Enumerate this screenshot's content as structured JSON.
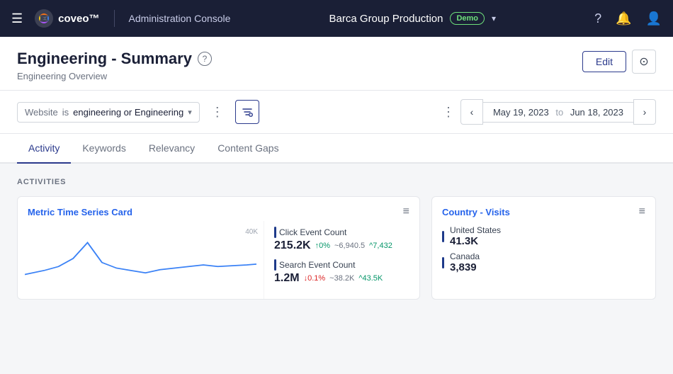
{
  "topnav": {
    "menu_icon": "☰",
    "logo_alt": "Coveo",
    "app_title": "Administration Console",
    "org_name": "Barca Group Production",
    "demo_badge": "Demo",
    "help_icon": "?",
    "bell_icon": "🔔",
    "user_icon": "👤"
  },
  "page": {
    "title": "Engineering - Summary",
    "subtitle": "Engineering Overview",
    "edit_label": "Edit",
    "settings_icon": "⊙"
  },
  "filter_bar": {
    "filter_label": "Website",
    "filter_is": "is",
    "filter_value": "engineering or Engineering",
    "more_icon": "⋮",
    "add_filter_icon": "+",
    "date_prev_icon": "‹",
    "date_next_icon": "›",
    "date_start": "May 19, 2023",
    "date_to": "to",
    "date_end": "Jun 18, 2023"
  },
  "tabs": [
    {
      "id": "activity",
      "label": "Activity",
      "active": true
    },
    {
      "id": "keywords",
      "label": "Keywords",
      "active": false
    },
    {
      "id": "relevancy",
      "label": "Relevancy",
      "active": false
    },
    {
      "id": "content-gaps",
      "label": "Content Gaps",
      "active": false
    }
  ],
  "activities_section": {
    "label": "ACTIVITIES"
  },
  "metric_card": {
    "title": "Metric Time Series Card",
    "chart_label": "40K",
    "metrics": [
      {
        "name": "Click Event Count",
        "value": "215.2K",
        "change1": "↑0%",
        "change2": "~6,940.5",
        "change3": "^7,432"
      },
      {
        "name": "Search Event Count",
        "value": "1.2M",
        "change1": "↓0.1%",
        "change2": "~38.2K",
        "change3": "^43.5K"
      }
    ]
  },
  "country_card": {
    "title": "Country - Visits",
    "countries": [
      {
        "name": "United States",
        "value": "41.3K"
      },
      {
        "name": "Canada",
        "value": "3,839"
      }
    ]
  }
}
